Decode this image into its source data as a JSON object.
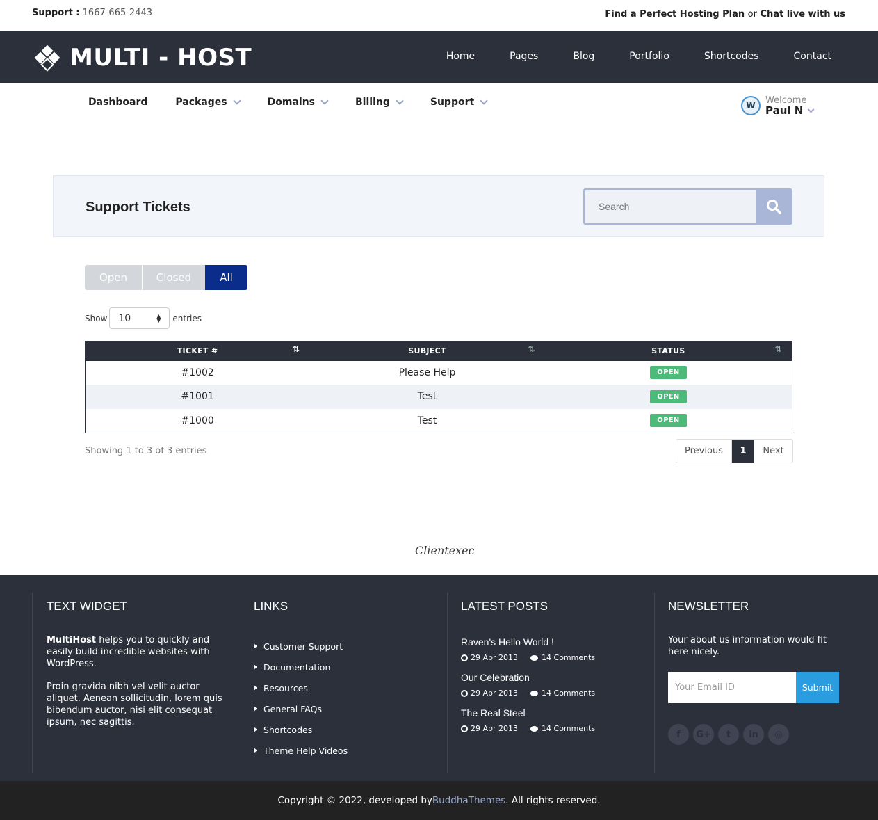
{
  "topbar": {
    "support_label": "Support :",
    "support_phone": "1667-665-2443",
    "find_plan": "Find a Perfect Hosting Plan",
    "or": "or",
    "chat": "Chat live with us"
  },
  "header": {
    "logo_text": "MULTI - HOST",
    "nav": [
      "Home",
      "Pages",
      "Blog",
      "Portfolio",
      "Shortcodes",
      "Contact"
    ]
  },
  "subnav": {
    "items": [
      "Dashboard",
      "Packages",
      "Domains",
      "Billing",
      "Support"
    ],
    "welcome": "Welcome",
    "user": "Paul N",
    "avatar_letter": "W"
  },
  "panel": {
    "title": "Support Tickets",
    "search_placeholder": "Search"
  },
  "filters": [
    "Open",
    "Closed",
    "All"
  ],
  "show": {
    "label": "Show",
    "value": "10",
    "suffix": "entries"
  },
  "table": {
    "headers": [
      "TICKET #",
      "SUBJECT",
      "STATUS"
    ],
    "rows": [
      {
        "ticket": "#1002",
        "subject": "Please Help",
        "status": "OPEN"
      },
      {
        "ticket": "#1001",
        "subject": "Test",
        "status": "OPEN"
      },
      {
        "ticket": "#1000",
        "subject": "Test",
        "status": "OPEN"
      }
    ]
  },
  "info": "Showing 1 to 3 of 3 entries",
  "pager": {
    "prev": "Previous",
    "page": "1",
    "next": "Next"
  },
  "brand": "Clientexec",
  "footer": {
    "text_widget": {
      "title": "TEXT WIDGET",
      "brand": "MultiHost",
      "p1": " helps you to quickly and easily build incredible websites with WordPress.",
      "p2": "Proin gravida nibh vel velit auctor aliquet. Aenean sollicitudin, lorem quis bibendum auctor, nisi elit consequat ipsum, nec sagittis."
    },
    "links": {
      "title": "LINKS",
      "items": [
        "Customer Support",
        "Documentation",
        "Resources",
        "General FAQs",
        "Shortcodes",
        "Theme Help Videos"
      ]
    },
    "posts": {
      "title": "LATEST POSTS",
      "items": [
        {
          "title": "Raven's Hello World !",
          "date": "29 Apr 2013",
          "comments": "14 Comments"
        },
        {
          "title": "Our Celebration",
          "date": "29 Apr 2013",
          "comments": "14 Comments"
        },
        {
          "title": "The Real Steel",
          "date": "29 Apr 2013",
          "comments": "14 Comments"
        }
      ]
    },
    "newsletter": {
      "title": "NEWSLETTER",
      "text": "Your about us information would fit here nicely.",
      "email_placeholder": "Your Email ID",
      "submit": "Submit"
    }
  },
  "copyright": {
    "pre": "Copyright © 2022, developed by ",
    "link": "BuddhaThemes",
    "post": ". All rights reserved."
  }
}
